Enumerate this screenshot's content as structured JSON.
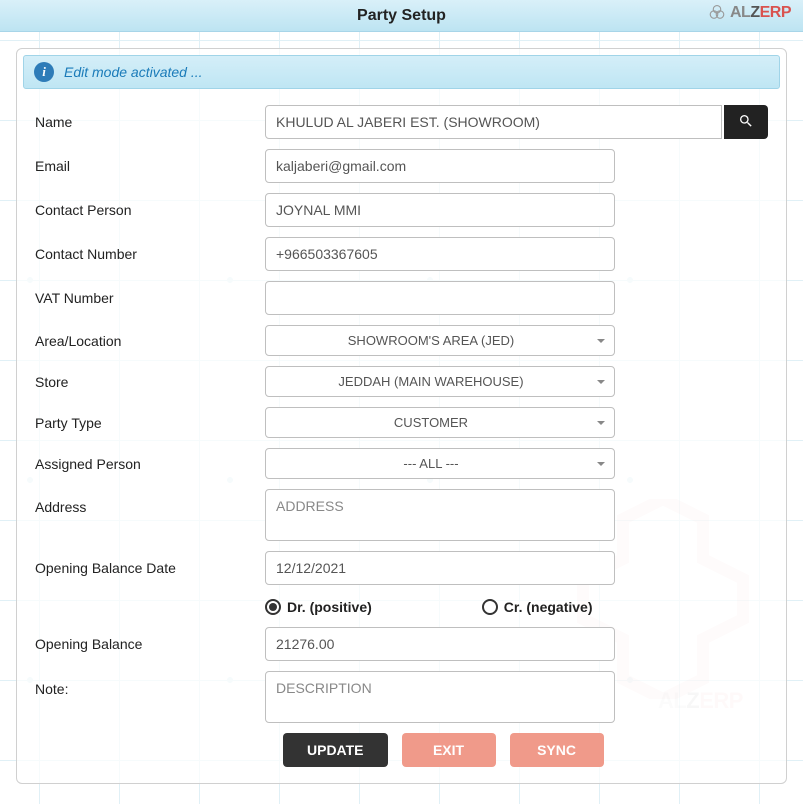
{
  "header": {
    "title": "Party Setup"
  },
  "logo": {
    "part1": "AL",
    "part2": "Z",
    "part3": "ERP"
  },
  "alert": {
    "text": "Edit mode activated ..."
  },
  "labels": {
    "name": "Name",
    "email": "Email",
    "contact_person": "Contact Person",
    "contact_number": "Contact Number",
    "vat_number": "VAT Number",
    "area": "Area/Location",
    "store": "Store",
    "party_type": "Party Type",
    "assigned_person": "Assigned Person",
    "address": "Address",
    "opening_balance_date": "Opening Balance Date",
    "opening_balance": "Opening Balance",
    "note": "Note:"
  },
  "values": {
    "name": "KHULUD AL JABERI EST. (SHOWROOM)",
    "email": "kaljaberi@gmail.com",
    "contact_person": "JOYNAL MMI",
    "contact_number": "+966503367605",
    "vat_number": "",
    "area": "SHOWROOM'S AREA (JED)",
    "store": "JEDDAH (MAIN WAREHOUSE)",
    "party_type": "CUSTOMER",
    "assigned_person": "--- ALL ---",
    "address_placeholder": "ADDRESS",
    "opening_balance_date": "12/12/2021",
    "opening_balance": "21276.00",
    "note_placeholder": "DESCRIPTION"
  },
  "radio": {
    "dr": "Dr. (positive)",
    "cr": "Cr. (negative)",
    "selected": "dr"
  },
  "buttons": {
    "update": "UPDATE",
    "exit": "EXIT",
    "sync": "SYNC"
  }
}
